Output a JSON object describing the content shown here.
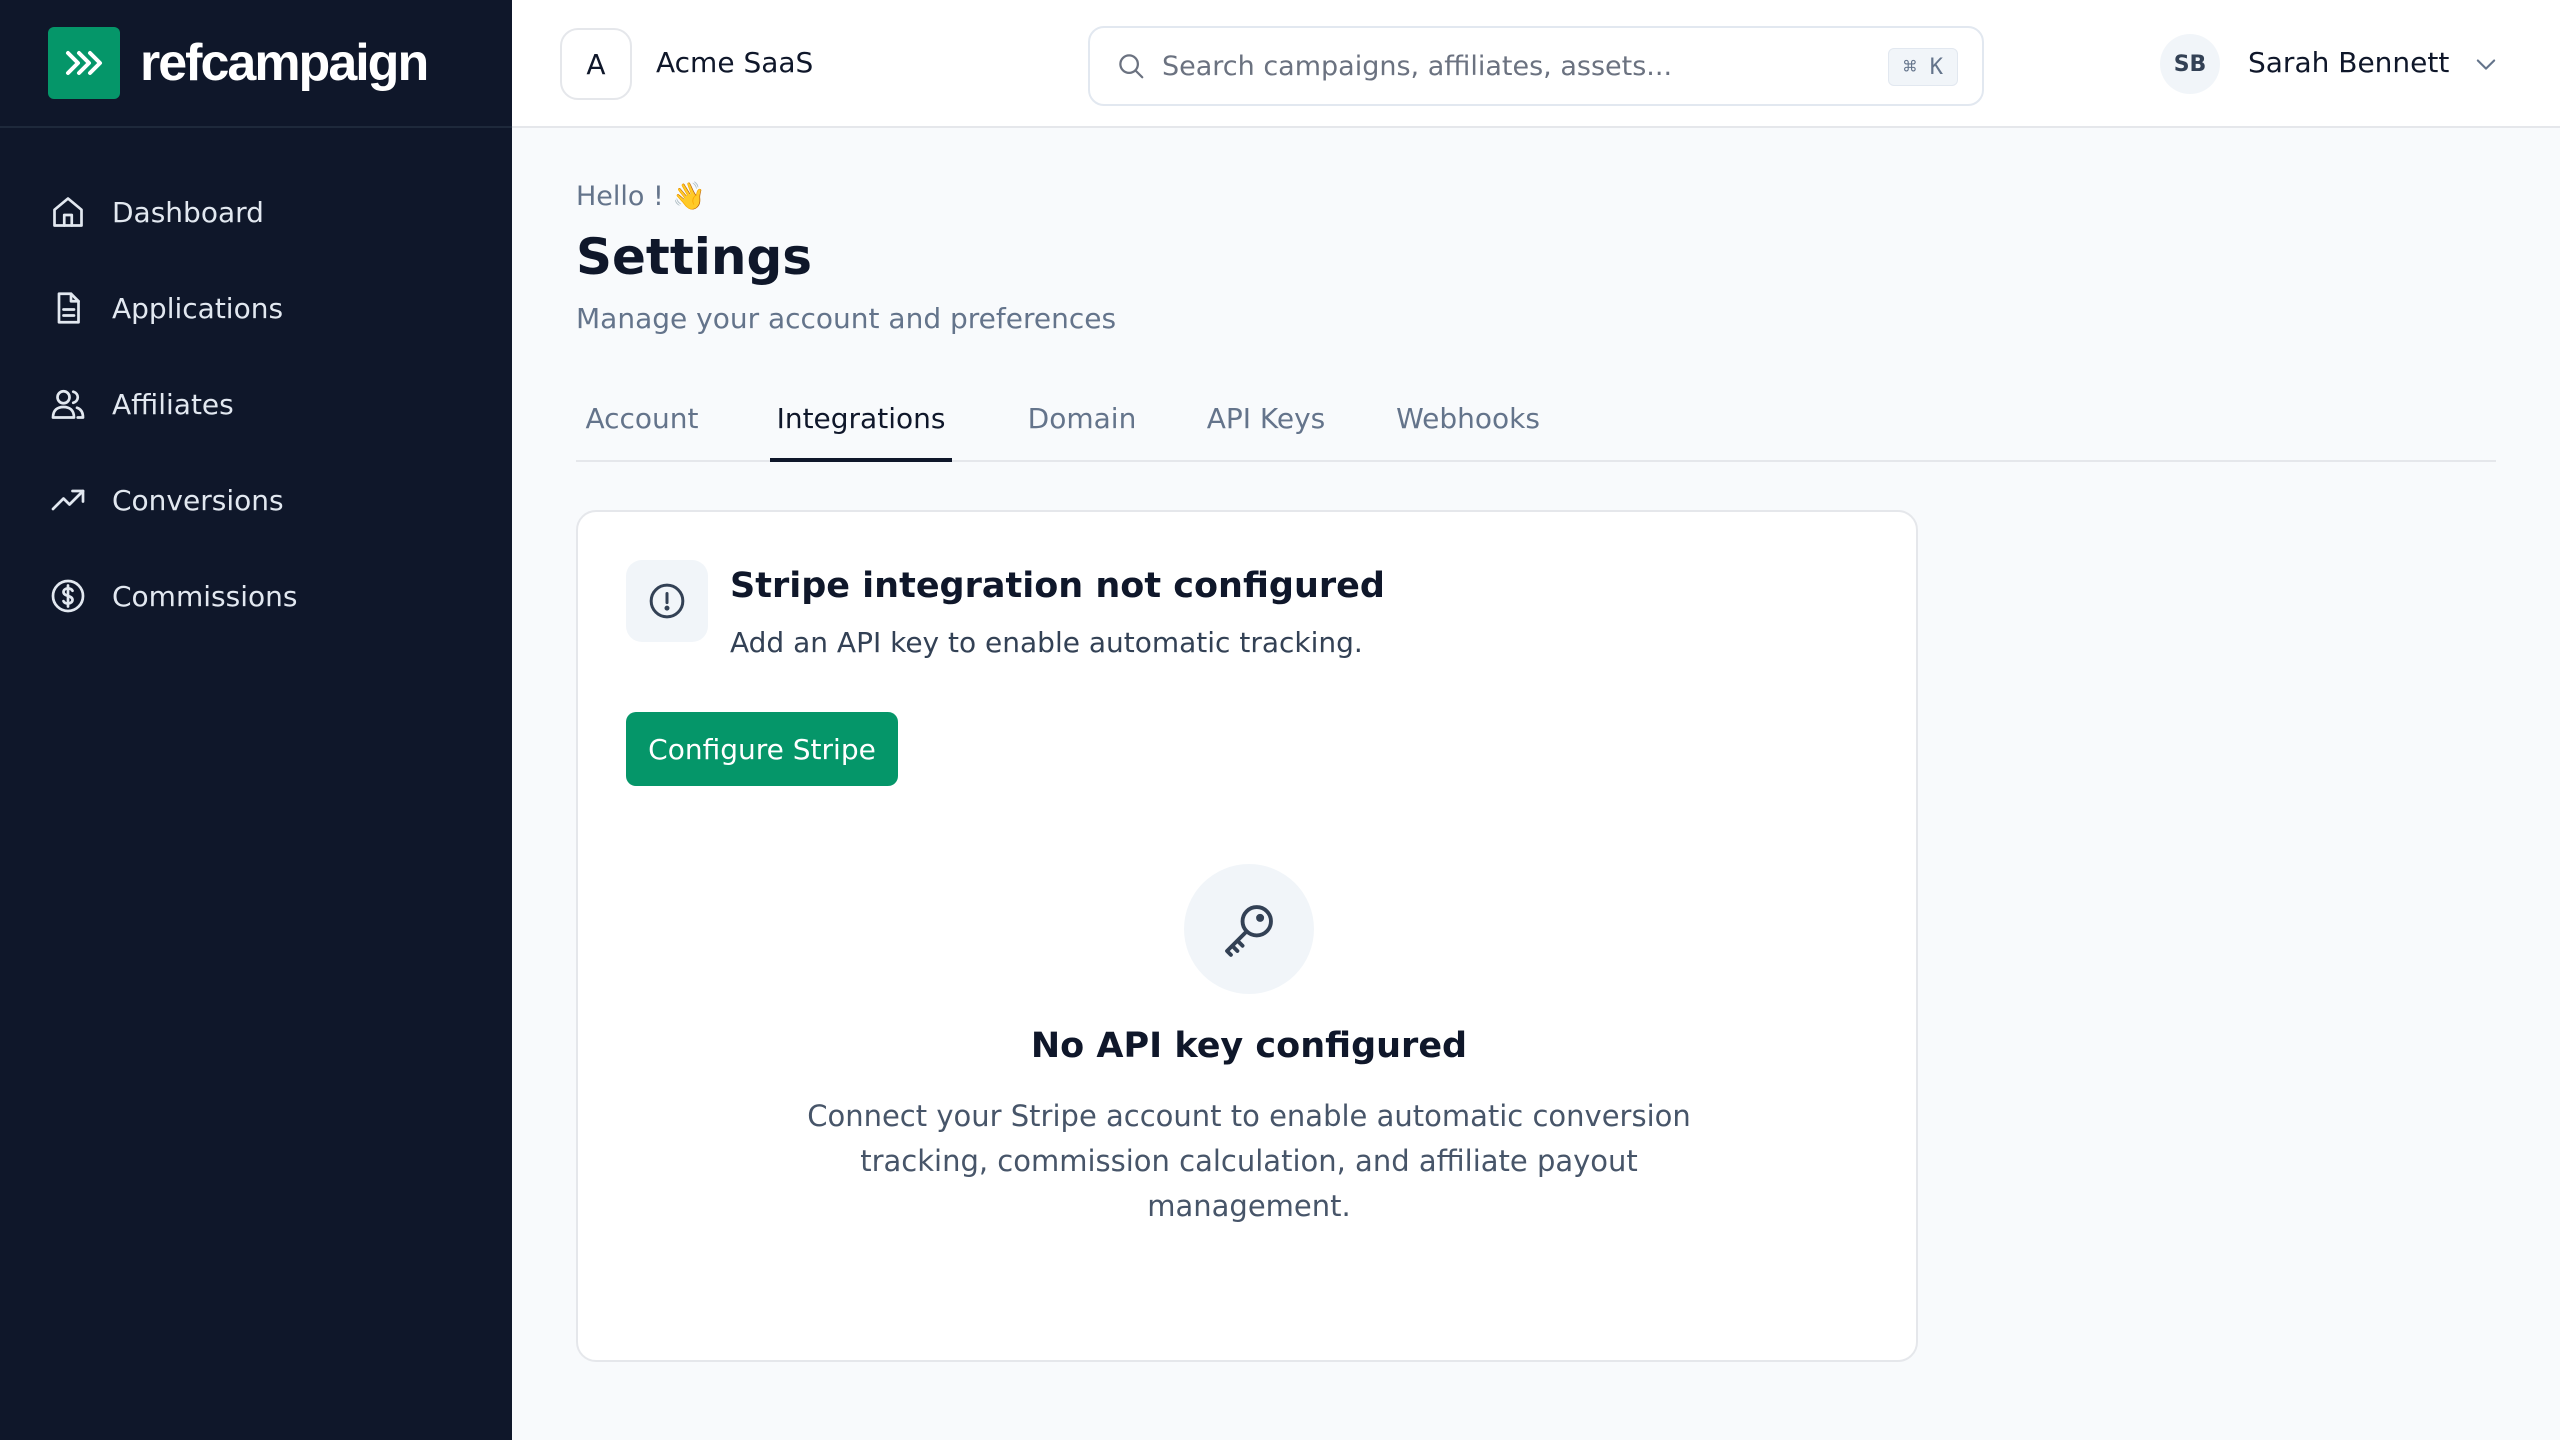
{
  "brand": {
    "name": "refcampaign",
    "accent": "#059669"
  },
  "sidebar": {
    "items": [
      {
        "label": "Dashboard",
        "icon": "home-icon"
      },
      {
        "label": "Applications",
        "icon": "document-icon"
      },
      {
        "label": "Affiliates",
        "icon": "users-icon"
      },
      {
        "label": "Conversions",
        "icon": "trending-up-icon"
      },
      {
        "label": "Commissions",
        "icon": "dollar-circle-icon"
      }
    ]
  },
  "header": {
    "org_initial": "A",
    "org_name": "Acme SaaS",
    "search_placeholder": "Search campaigns, affiliates, assets...",
    "shortcut": "⌘ K",
    "user_initials": "SB",
    "user_name": "Sarah Bennett"
  },
  "page": {
    "greeting": "Hello ! 👋",
    "title": "Settings",
    "subtitle": "Manage your account and preferences"
  },
  "tabs": [
    {
      "label": "Account"
    },
    {
      "label": "Integrations",
      "active": true
    },
    {
      "label": "Domain"
    },
    {
      "label": "API Keys"
    },
    {
      "label": "Webhooks"
    }
  ],
  "integration": {
    "alert_title": "Stripe integration not configured",
    "alert_desc": "Add an API key to enable automatic tracking.",
    "button_label": "Configure Stripe",
    "empty_title": "No API key configured",
    "empty_desc": "Connect your Stripe account to enable automatic conversion tracking, commission calculation, and affiliate payout management."
  }
}
